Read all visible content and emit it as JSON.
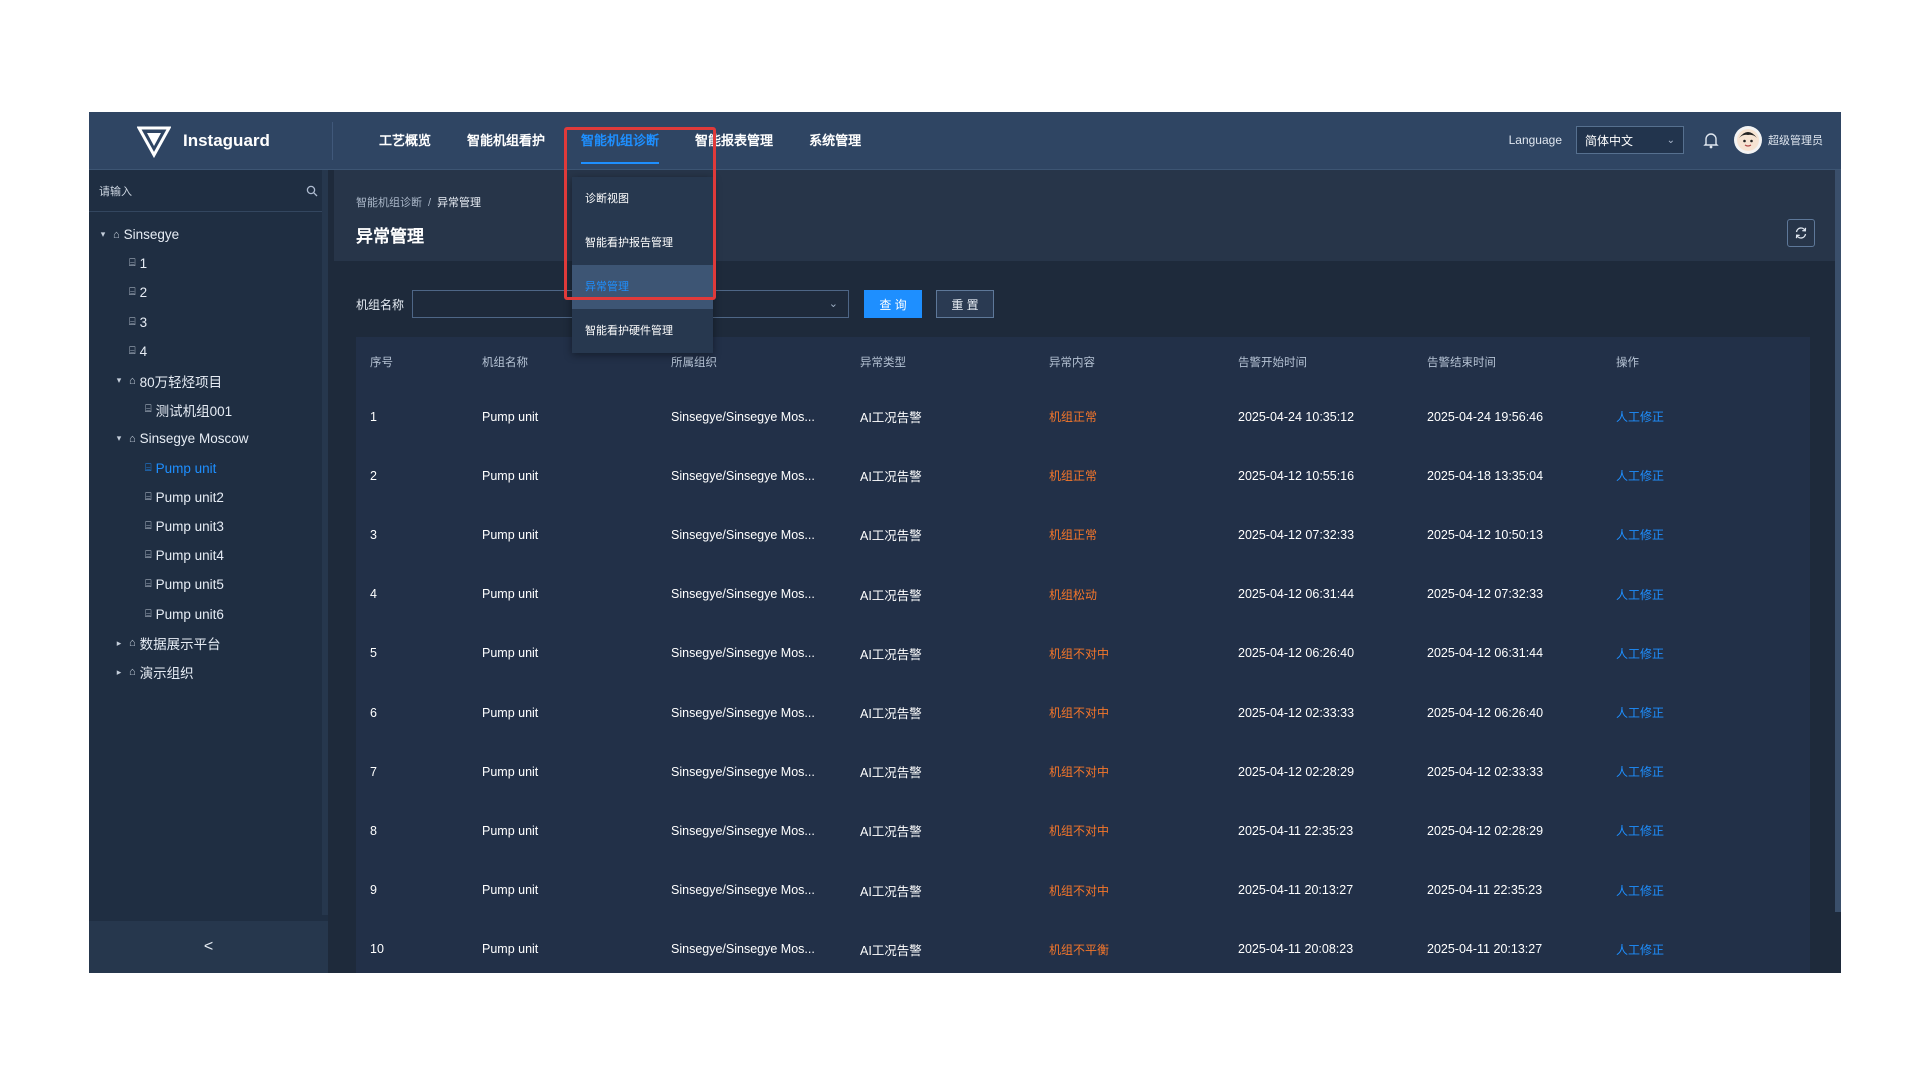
{
  "brand": {
    "name": "Instaguard"
  },
  "nav": {
    "items": [
      "工艺概览",
      "智能机组看护",
      "智能机组诊断",
      "智能报表管理",
      "系统管理"
    ],
    "active_index": 2
  },
  "top_right": {
    "language_label": "Language",
    "language_value": "简体中文",
    "user": "超级管理员"
  },
  "dropdown": {
    "items": [
      "诊断视图",
      "智能看护报告管理",
      "异常管理",
      "智能看护硬件管理"
    ],
    "active_index": 2
  },
  "sidebar": {
    "search_placeholder": "请输入",
    "tree": [
      {
        "label": "Sinsegye",
        "level": 0,
        "type": "org",
        "expanded": true
      },
      {
        "label": "1",
        "level": 1,
        "type": "unit"
      },
      {
        "label": "2",
        "level": 1,
        "type": "unit"
      },
      {
        "label": "3",
        "level": 1,
        "type": "unit"
      },
      {
        "label": "4",
        "level": 1,
        "type": "unit"
      },
      {
        "label": "80万轻烃项目",
        "level": 1,
        "type": "org",
        "expanded": true
      },
      {
        "label": "测试机组001",
        "level": 2,
        "type": "unit"
      },
      {
        "label": "Sinsegye Moscow",
        "level": 1,
        "type": "org",
        "expanded": true
      },
      {
        "label": "Pump unit",
        "level": 2,
        "type": "unit",
        "selected": true
      },
      {
        "label": "Pump unit2",
        "level": 2,
        "type": "unit"
      },
      {
        "label": "Pump unit3",
        "level": 2,
        "type": "unit"
      },
      {
        "label": "Pump unit4",
        "level": 2,
        "type": "unit"
      },
      {
        "label": "Pump unit5",
        "level": 2,
        "type": "unit"
      },
      {
        "label": "Pump unit6",
        "level": 2,
        "type": "unit"
      },
      {
        "label": "数据展示平台",
        "level": 1,
        "type": "org",
        "expanded": false
      },
      {
        "label": "演示组织",
        "level": 1,
        "type": "org",
        "expanded": false
      }
    ],
    "collapse_label": "<"
  },
  "breadcrumb": {
    "parent": "智能机组诊断",
    "separator": "/",
    "current": "异常管理"
  },
  "page_title": "异常管理",
  "filters": {
    "label": "机组名称",
    "query_label": "查 询",
    "reset_label": "重 置"
  },
  "table": {
    "headers": [
      "序号",
      "机组名称",
      "所属组织",
      "异常类型",
      "异常内容",
      "告警开始时间",
      "告警结束时间",
      "操作"
    ],
    "rows": [
      [
        "1",
        "Pump unit",
        "Sinsegye/Sinsegye Mos...",
        "AI工况告警",
        "机组正常",
        "2025-04-24 10:35:12",
        "2025-04-24 19:56:46",
        "人工修正"
      ],
      [
        "2",
        "Pump unit",
        "Sinsegye/Sinsegye Mos...",
        "AI工况告警",
        "机组正常",
        "2025-04-12 10:55:16",
        "2025-04-18 13:35:04",
        "人工修正"
      ],
      [
        "3",
        "Pump unit",
        "Sinsegye/Sinsegye Mos...",
        "AI工况告警",
        "机组正常",
        "2025-04-12 07:32:33",
        "2025-04-12 10:50:13",
        "人工修正"
      ],
      [
        "4",
        "Pump unit",
        "Sinsegye/Sinsegye Mos...",
        "AI工况告警",
        "机组松动",
        "2025-04-12 06:31:44",
        "2025-04-12 07:32:33",
        "人工修正"
      ],
      [
        "5",
        "Pump unit",
        "Sinsegye/Sinsegye Mos...",
        "AI工况告警",
        "机组不对中",
        "2025-04-12 06:26:40",
        "2025-04-12 06:31:44",
        "人工修正"
      ],
      [
        "6",
        "Pump unit",
        "Sinsegye/Sinsegye Mos...",
        "AI工况告警",
        "机组不对中",
        "2025-04-12 02:33:33",
        "2025-04-12 06:26:40",
        "人工修正"
      ],
      [
        "7",
        "Pump unit",
        "Sinsegye/Sinsegye Mos...",
        "AI工况告警",
        "机组不对中",
        "2025-04-12 02:28:29",
        "2025-04-12 02:33:33",
        "人工修正"
      ],
      [
        "8",
        "Pump unit",
        "Sinsegye/Sinsegye Mos...",
        "AI工况告警",
        "机组不对中",
        "2025-04-11 22:35:23",
        "2025-04-12 02:28:29",
        "人工修正"
      ],
      [
        "9",
        "Pump unit",
        "Sinsegye/Sinsegye Mos...",
        "AI工况告警",
        "机组不对中",
        "2025-04-11 20:13:27",
        "2025-04-11 22:35:23",
        "人工修正"
      ],
      [
        "10",
        "Pump unit",
        "Sinsegye/Sinsegye Mos...",
        "AI工况告警",
        "机组不平衡",
        "2025-04-11 20:08:23",
        "2025-04-11 20:13:27",
        "人工修正"
      ]
    ]
  },
  "colors": {
    "accent": "#1e8fff",
    "anomaly": "#f5762a",
    "highlight": "#e03a3a"
  }
}
